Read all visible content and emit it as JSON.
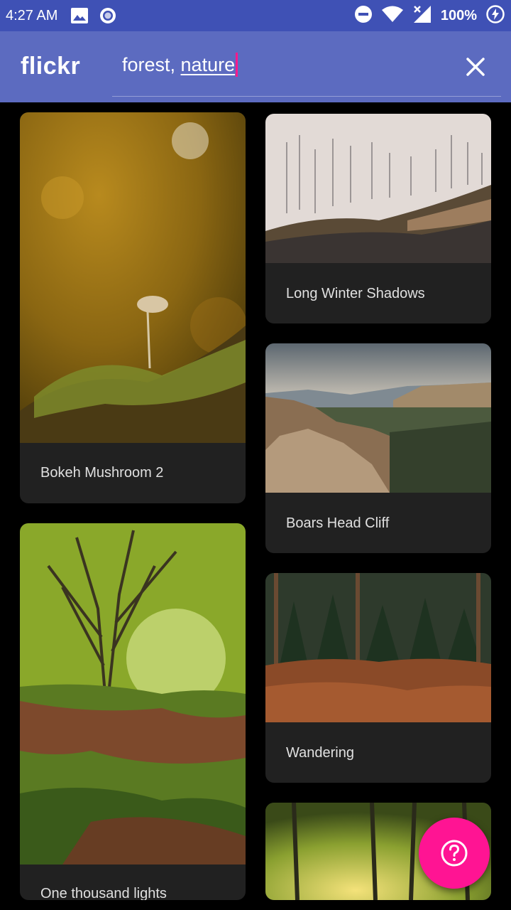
{
  "status_bar": {
    "time": "4:27 AM",
    "battery": "100%",
    "icons": [
      "image-icon",
      "circle-app-icon",
      "do-not-disturb-icon",
      "wifi-icon",
      "no-signal-icon",
      "battery-charging-icon"
    ]
  },
  "app_bar": {
    "logo": "flickr",
    "search": {
      "value_plain": "forest, ",
      "value_underlined": "nature"
    },
    "clear_icon": "close-icon"
  },
  "photos": [
    {
      "title": "Bokeh Mushroom 2"
    },
    {
      "title": "Long Winter Shadows"
    },
    {
      "title": "Boars Head Cliff"
    },
    {
      "title": "Wandering"
    },
    {
      "title": "One thousand lights"
    },
    {
      "title": ""
    }
  ],
  "fab": {
    "icon": "help-icon"
  },
  "colors": {
    "status_bar": "#3f51b5",
    "app_bar": "#5c6bc0",
    "card": "#212121",
    "fab": "#ff1493",
    "caret": "#ff1a8c"
  }
}
